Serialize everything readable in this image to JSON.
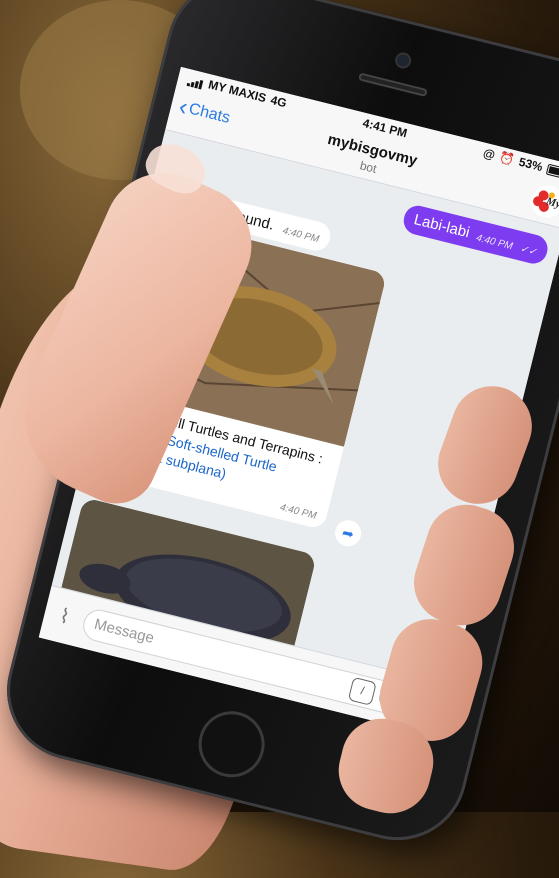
{
  "statusbar": {
    "carrier": "MY MAXIS",
    "network": "4G",
    "time": "4:41 PM",
    "battery": "53%",
    "battery_level": 0.53
  },
  "header": {
    "back_label": "Chats",
    "title": "mybisgovmy",
    "subtitle": "bot",
    "avatar_text": "My"
  },
  "messages": {
    "outgoing": {
      "text": "Labi-labi",
      "time": "4:40 PM"
    },
    "incoming": {
      "text": "5 records found.",
      "time": "4:40 PM"
    },
    "card": {
      "prefix": "1) Softshell Turtles and Terrapins : ",
      "link": "Malayan Soft-shelled Turtle (Dogania subplana)",
      "time": "4:40 PM"
    }
  },
  "composer": {
    "placeholder": "Message"
  },
  "icons": {
    "back": "chevron-left-icon",
    "attach": "paperclip-icon",
    "mic": "microphone-icon",
    "share": "share-icon",
    "scroll": "chevron-down-icon"
  },
  "colors": {
    "accent": "#2a7ae4",
    "outgoing_bubble": "#7d3cf0",
    "link": "#1b66c9"
  }
}
